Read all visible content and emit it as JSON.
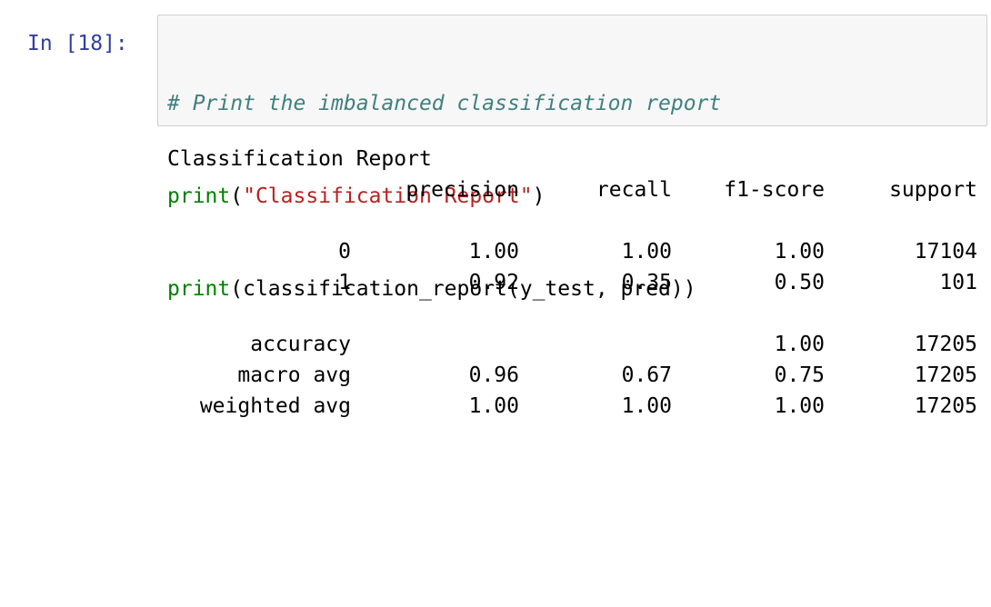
{
  "cell": {
    "prompt": "In [18]:",
    "code_lines": [
      [
        {
          "cls": "cm-comment",
          "text": "# Print the imbalanced classification report"
        }
      ],
      [
        {
          "cls": "cm-builtin",
          "text": "print"
        },
        {
          "cls": "cm-punct",
          "text": "("
        },
        {
          "cls": "cm-string",
          "text": "\"Classification Report\""
        },
        {
          "cls": "cm-punct",
          "text": ")"
        }
      ],
      [
        {
          "cls": "cm-builtin",
          "text": "print"
        },
        {
          "cls": "cm-punct",
          "text": "(classification_report(y_test, pred))"
        }
      ]
    ]
  },
  "output": {
    "title": "Classification Report",
    "header": {
      "label": "",
      "precision": "precision",
      "recall": "recall",
      "f1": "f1-score",
      "support": "support"
    },
    "class_rows": [
      {
        "label": "0",
        "precision": "1.00",
        "recall": "1.00",
        "f1": "1.00",
        "support": "17104"
      },
      {
        "label": "1",
        "precision": "0.92",
        "recall": "0.35",
        "f1": "0.50",
        "support": "101"
      }
    ],
    "summary_rows": [
      {
        "label": "accuracy",
        "precision": "",
        "recall": "",
        "f1": "1.00",
        "support": "17205"
      },
      {
        "label": "macro avg",
        "precision": "0.96",
        "recall": "0.67",
        "f1": "0.75",
        "support": "17205"
      },
      {
        "label": "weighted avg",
        "precision": "1.00",
        "recall": "1.00",
        "f1": "1.00",
        "support": "17205"
      }
    ]
  },
  "colors": {
    "prompt": "#303f9f",
    "comment": "#408080",
    "builtin": "#008000",
    "string": "#ba2121",
    "input_bg": "#f7f7f7",
    "input_border": "#cfcfcf"
  }
}
